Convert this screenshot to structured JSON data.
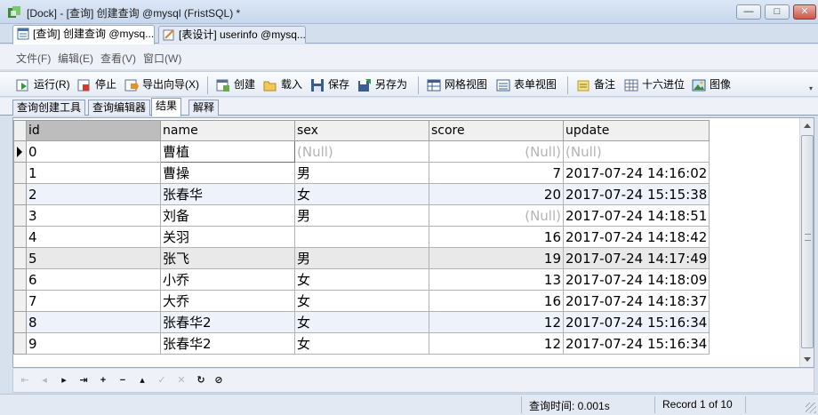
{
  "window": {
    "title": "[Dock] - [查询] 创建查询 @mysql (FristSQL) *",
    "controls": {
      "minimize": "—",
      "maximize": "□",
      "close": "✕"
    }
  },
  "doc_tabs": [
    {
      "label": "[查询] 创建查询 @mysq...",
      "active": true
    },
    {
      "label": "[表设计] userinfo @mysq...",
      "active": false
    }
  ],
  "menu": {
    "file": "文件(F)",
    "edit": "编辑(E)",
    "view": "查看(V)",
    "window": "窗口(W)"
  },
  "toolbar": {
    "run": "运行(R)",
    "stop": "停止",
    "export": "导出向导(X)",
    "create": "创建",
    "load": "载入",
    "save": "保存",
    "save_as": "另存为",
    "grid_view": "网格视图",
    "form_view": "表单视图",
    "memo": "备注",
    "hex": "十六进位",
    "image": "图像"
  },
  "sub_tabs": [
    {
      "label": "查询创建工具",
      "active": false
    },
    {
      "label": "查询编辑器",
      "active": false
    },
    {
      "label": "结果",
      "active": true
    },
    {
      "label": "解释",
      "active": false
    }
  ],
  "grid": {
    "columns": [
      "id",
      "name",
      "sex",
      "score",
      "update"
    ],
    "null_text": "(Null)",
    "rows": [
      {
        "id": "0",
        "name": "曹植",
        "sex": "(Null)",
        "score": "(Null)",
        "update": "(Null)"
      },
      {
        "id": "1",
        "name": "曹操",
        "sex": "男",
        "score": "7",
        "update": "2017-07-24 14:16:02"
      },
      {
        "id": "2",
        "name": "张春华",
        "sex": "女",
        "score": "20",
        "update": "2017-07-24 15:15:38"
      },
      {
        "id": "3",
        "name": "刘备",
        "sex": "男",
        "score": "(Null)",
        "update": "2017-07-24 14:18:51"
      },
      {
        "id": "4",
        "name": "关羽",
        "sex": "",
        "score": "16",
        "update": "2017-07-24 14:18:42"
      },
      {
        "id": "5",
        "name": "张飞",
        "sex": "男",
        "score": "19",
        "update": "2017-07-24 14:17:49"
      },
      {
        "id": "6",
        "name": "小乔",
        "sex": "女",
        "score": "13",
        "update": "2017-07-24 14:18:09"
      },
      {
        "id": "7",
        "name": "大乔",
        "sex": "女",
        "score": "16",
        "update": "2017-07-24 14:18:37"
      },
      {
        "id": "8",
        "name": "张春华2",
        "sex": "女",
        "score": "12",
        "update": "2017-07-24 15:16:34"
      },
      {
        "id": "9",
        "name": "张春华2",
        "sex": "女",
        "score": "12",
        "update": "2017-07-24 15:16:34"
      }
    ]
  },
  "nav_icons": [
    "first-record-icon",
    "previous-record-icon",
    "next-record-icon",
    "last-record-icon",
    "add-record-icon",
    "delete-record-icon",
    "move-up-icon",
    "apply-icon",
    "discard-icon",
    "refresh-icon",
    "stop-icon"
  ],
  "status": {
    "query_time": "查询时间: 0.001s",
    "record": "Record 1 of 10"
  }
}
